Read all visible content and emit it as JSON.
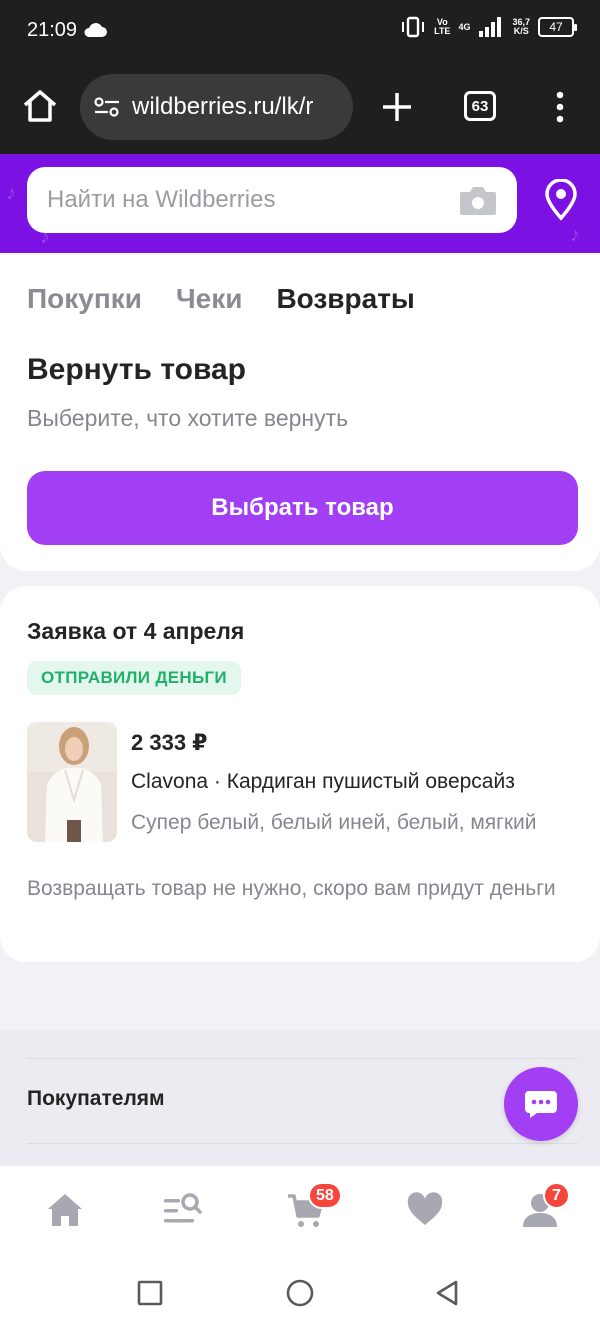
{
  "status_bar": {
    "time": "21:09",
    "network_label_top": "Vo",
    "network_label_bottom": "LTE",
    "gen_label": "4G",
    "speed_top": "36,7",
    "speed_bottom": "K/S",
    "battery": "47",
    "icons": [
      "cloud-icon",
      "vibrate-icon",
      "signal-icon",
      "battery-icon"
    ]
  },
  "browser": {
    "url": "wildberries.ru/lk/r",
    "tabs_count": "63",
    "icons": [
      "home-icon",
      "tune-icon",
      "plus-icon",
      "more-vertical-icon"
    ]
  },
  "header": {
    "search_placeholder": "Найти на Wildberries",
    "brand_color": "#7b11e3",
    "icons": [
      "camera-icon",
      "location-pin-icon"
    ]
  },
  "tabs": [
    {
      "label": "Покупки",
      "active": false
    },
    {
      "label": "Чеки",
      "active": false
    },
    {
      "label": "Возвраты",
      "active": true
    }
  ],
  "returns": {
    "title": "Вернуть товар",
    "subtitle": "Выберите, что хотите вернуть",
    "button_label": "Выбрать товар",
    "accent_color": "#a23ff5"
  },
  "request": {
    "title": "Заявка от 4 апреля",
    "status": "ОТПРАВИЛИ ДЕНЬГИ",
    "status_color": "#1fb069",
    "product": {
      "price": "2 333 ₽",
      "name": "Clavona · Кардиган пушистый оверсайз",
      "color": "Супер белый, белый иней, белый, мягкий"
    },
    "note": "Возвращать товар не нужно, скоро вам придут деньги"
  },
  "footer": {
    "link": "Покупателям",
    "chat_icon": "chat-bubble-icon"
  },
  "bottom_nav": {
    "items": [
      "home-icon",
      "catalog-search-icon",
      "cart-icon",
      "heart-icon",
      "profile-icon"
    ],
    "cart_badge": "58",
    "profile_badge": "7",
    "badge_color": "#f5463c"
  },
  "system_nav": [
    "recents-square-icon",
    "home-circle-icon",
    "back-triangle-icon"
  ]
}
